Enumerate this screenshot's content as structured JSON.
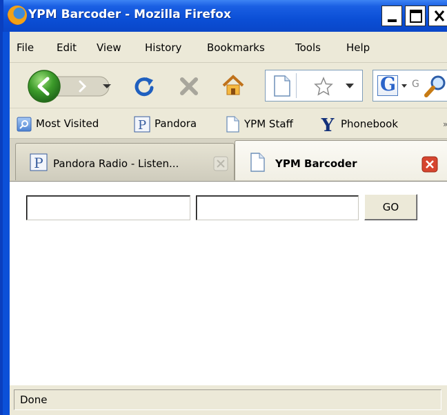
{
  "window": {
    "title": "YPM Barcoder - Mozilla Firefox",
    "controls": [
      "minimize",
      "maximize",
      "close"
    ]
  },
  "menubar": {
    "items": [
      {
        "label": "File"
      },
      {
        "label": "Edit"
      },
      {
        "label": "View"
      },
      {
        "label": "History"
      },
      {
        "label": "Bookmarks"
      },
      {
        "label": "Tools"
      },
      {
        "label": "Help"
      }
    ]
  },
  "navbar": {
    "buttons": [
      "back-button",
      "forward-button",
      "history-dropdown",
      "reload-button",
      "stop-button",
      "home-button"
    ],
    "address_value": "",
    "search_engine_letter": "G"
  },
  "bookmarks": {
    "items": [
      {
        "label": "Most Visited",
        "icon": "rss-folder-icon"
      },
      {
        "label": "Pandora",
        "icon": "pandora-icon"
      },
      {
        "label": "YPM Staff",
        "icon": "page-icon"
      },
      {
        "label": "Phonebook",
        "icon": "yale-y-icon"
      }
    ]
  },
  "tabs": [
    {
      "label": "Pandora Radio - Listen...",
      "icon": "pandora-icon",
      "active": false
    },
    {
      "label": "YPM Barcoder",
      "icon": "page-icon",
      "active": true
    }
  ],
  "page": {
    "field1_value": "",
    "field2_value": "",
    "go_label": "GO"
  },
  "status": {
    "text": "Done"
  },
  "colors": {
    "titlebar": "#0b50d8",
    "chrome": "#ece9d8",
    "close_red": "#d6452f",
    "back_green": "#3c9b2a"
  }
}
